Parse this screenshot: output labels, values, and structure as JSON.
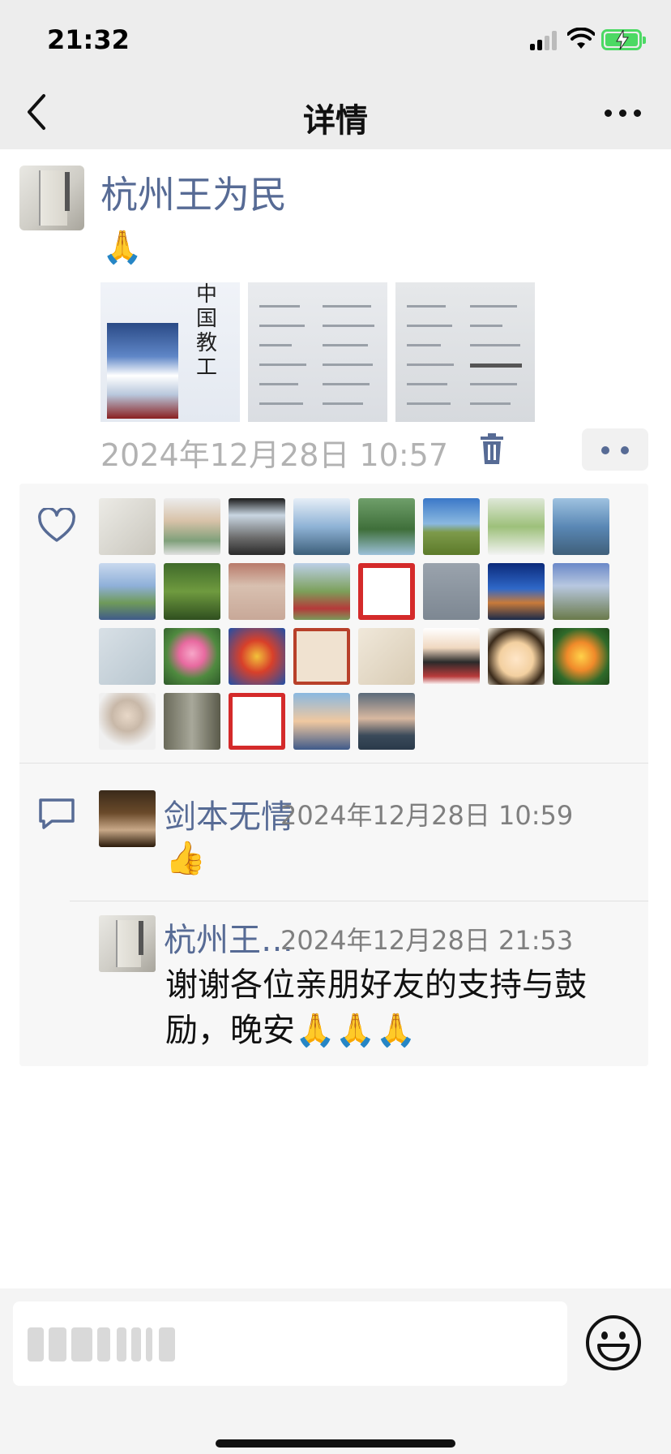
{
  "status_bar": {
    "time": "21:32"
  },
  "nav": {
    "title": "详情"
  },
  "post": {
    "author": "杭州王为民",
    "text": "🙏",
    "image_text": "中国教工",
    "timestamp": "2024年12月28日 10:57"
  },
  "likes": {
    "count": 28
  },
  "comments": [
    {
      "author": "剑本无情",
      "time": "2024年12月28日 10:59",
      "text": "👍"
    },
    {
      "author": "杭州王…",
      "time": "2024年12月28日 21:53",
      "text_line1": "谢谢各位亲朋好友的支持与鼓",
      "text_line2": "励，晚安🙏🙏🙏"
    }
  ],
  "input": {
    "placeholder": ""
  },
  "colors": {
    "link": "#576b95",
    "timestamp": "#b2b2b2",
    "battery": "#4cd964"
  }
}
